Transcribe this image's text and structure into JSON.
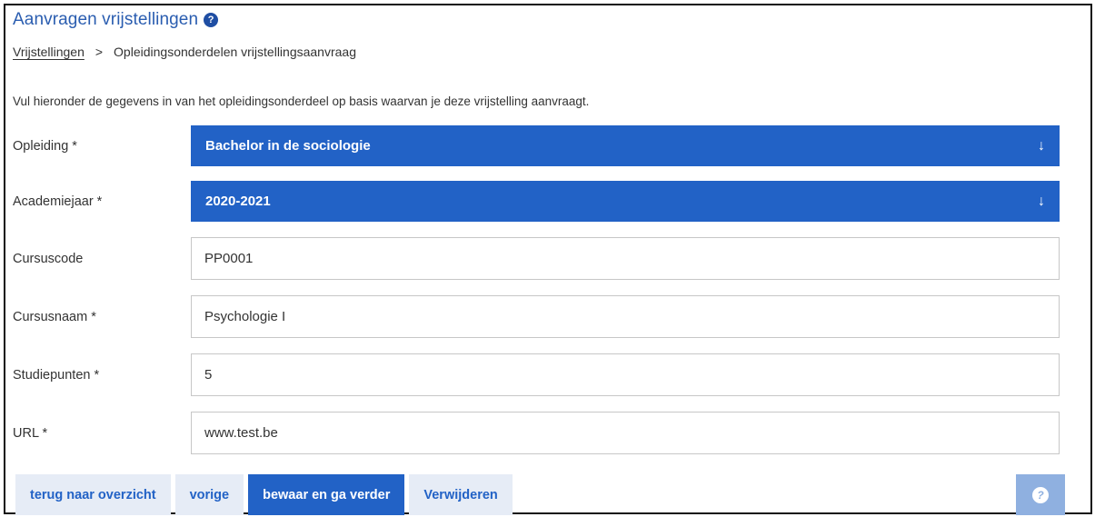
{
  "header": {
    "title": "Aanvragen vrijstellingen",
    "help_icon": "?"
  },
  "breadcrumb": {
    "items": [
      "Vrijstellingen",
      "Opleidingsonderdelen vrijstellingsaanvraag"
    ],
    "separator": ">"
  },
  "intro_text": "Vul hieronder de gegevens in van het opleidingsonderdeel op basis waarvan je deze vrijstelling aanvraagt.",
  "form": {
    "opleiding": {
      "label": "Opleiding *",
      "value": "Bachelor in de sociologie",
      "icon": "↓"
    },
    "academiejaar": {
      "label": "Academiejaar *",
      "value": "2020-2021",
      "icon": "↓"
    },
    "cursuscode": {
      "label": "Cursuscode",
      "value": "PP0001"
    },
    "cursusnaam": {
      "label": "Cursusnaam *",
      "value": "Psychologie I"
    },
    "studiepunten": {
      "label": "Studiepunten *",
      "value": "5"
    },
    "url": {
      "label": "URL *",
      "value": "www.test.be"
    }
  },
  "buttons": {
    "overview": "terug naar overzicht",
    "previous": "vorige",
    "save_next": "bewaar en ga verder",
    "delete": "Verwijderen",
    "help": "?"
  },
  "colors": {
    "accent": "#2262c6",
    "title": "#2a5db0",
    "secondary_button_bg": "#e6ecf6",
    "help_button_bg": "#8fb0e0"
  }
}
